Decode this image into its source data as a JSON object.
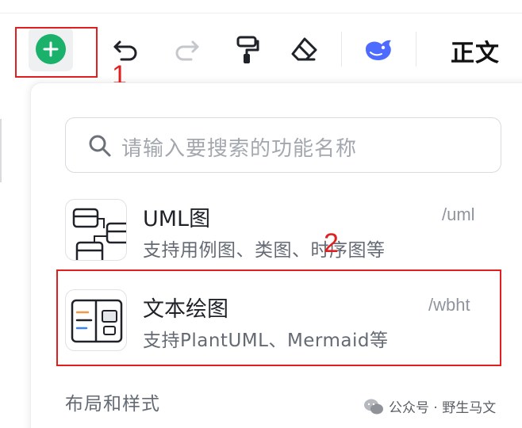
{
  "toolbar": {
    "heading_style": "正文",
    "icons": [
      "plus-circle-icon",
      "undo-icon",
      "redo-icon",
      "format-painter-icon",
      "eraser-icon",
      "deepseek-icon"
    ]
  },
  "annotations": {
    "step1": "1",
    "step2": "2"
  },
  "search": {
    "placeholder": "请输入要搜索的功能名称"
  },
  "items": [
    {
      "title": "UML图",
      "desc": "支持用例图、类图、时序图等",
      "command": "/uml"
    },
    {
      "title": "文本绘图",
      "desc": "支持PlantUML、Mermaid等",
      "command": "/wbht"
    }
  ],
  "section": {
    "label": "布局和样式"
  },
  "watermark": {
    "text": "公众号 · 野生马文"
  },
  "colors": {
    "accent_green": "#1ab26b",
    "annotation_red": "#e02020",
    "deepseek_blue": "#4d6bfe"
  }
}
